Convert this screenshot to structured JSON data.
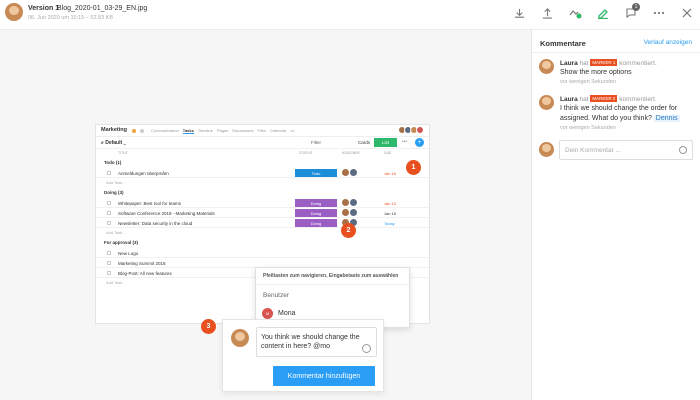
{
  "header": {
    "version": "Version 1",
    "filename": "Blog_2020-01_03-29_EN.jpg",
    "subtitle": "06. Jun 2020 um 10:15 – 52.83 KB",
    "notification_count": "1"
  },
  "screenshot": {
    "brand": "Marketing",
    "tabs": [
      "Communication",
      "Tasks",
      "Timeline",
      "Pages",
      "Discussions",
      "Files",
      "Calendar",
      "•••"
    ],
    "view": "Default",
    "filter": "Filter",
    "cards": "Cards",
    "list": "List",
    "columns": [
      "TITLE",
      "STATUS",
      "ASSIGNEE",
      "DUE"
    ],
    "add_task": "Add Task...",
    "groups": [
      {
        "name": "Todo (1)",
        "rows": [
          {
            "title": "Anmeldungen überprüfen",
            "status": "Todo",
            "due": "Jan 16"
          }
        ]
      },
      {
        "name": "Doing (3)",
        "rows": [
          {
            "title": "Whitepaper: Best tool for teams",
            "status": "Doing",
            "due": "Jan 12"
          },
          {
            "title": "Software Conference 2018 - Marketing Materials",
            "status": "Doing",
            "due": "Jan 15"
          },
          {
            "title": "Newsletter: Data security in the cloud",
            "status": "Doing",
            "due": "Today"
          }
        ]
      },
      {
        "name": "For approval (3)",
        "rows": [
          {
            "title": "New Logo",
            "status": "",
            "due": ""
          },
          {
            "title": "Marketing Summit 2018",
            "status": "",
            "due": ""
          },
          {
            "title": "Blog-Post: All new features",
            "status": "",
            "due": ""
          }
        ]
      }
    ]
  },
  "markers": [
    "1",
    "2",
    "3"
  ],
  "dropdown": {
    "hint": "Pfeiltasten zum navigieren, Eingabetaste zum auswählen",
    "group": "Benutzer",
    "user_initial": "M",
    "user": "Mona"
  },
  "popup": {
    "input_value": "You think we should change the content in here? @mo",
    "button": "Kommentar hinzufügen"
  },
  "panel": {
    "title": "Kommentare",
    "history_link": "Verlauf anzeigen",
    "comments": [
      {
        "author": "Laura",
        "verb_pre": "hat",
        "marker": "MARKER 1",
        "verb_post": "kommentiert.",
        "text": "Show the more options",
        "time": "vor wenigen Sekunden"
      },
      {
        "author": "Laura",
        "verb_pre": "hat",
        "marker": "MARKER 2",
        "verb_post": "kommentiert.",
        "text": "I think we should change the order for assigned. What do you think?",
        "mention": "Dennis",
        "time": "vor wenigen Sekunden"
      }
    ],
    "new_comment_placeholder": "Dein Kommentar ..."
  },
  "colors": {
    "accent": "#2a9df4",
    "marker": "#e8501f",
    "todo_status": "#1c8ed9",
    "doing_status": "#9b5fc4",
    "list_button": "#2db86b"
  }
}
